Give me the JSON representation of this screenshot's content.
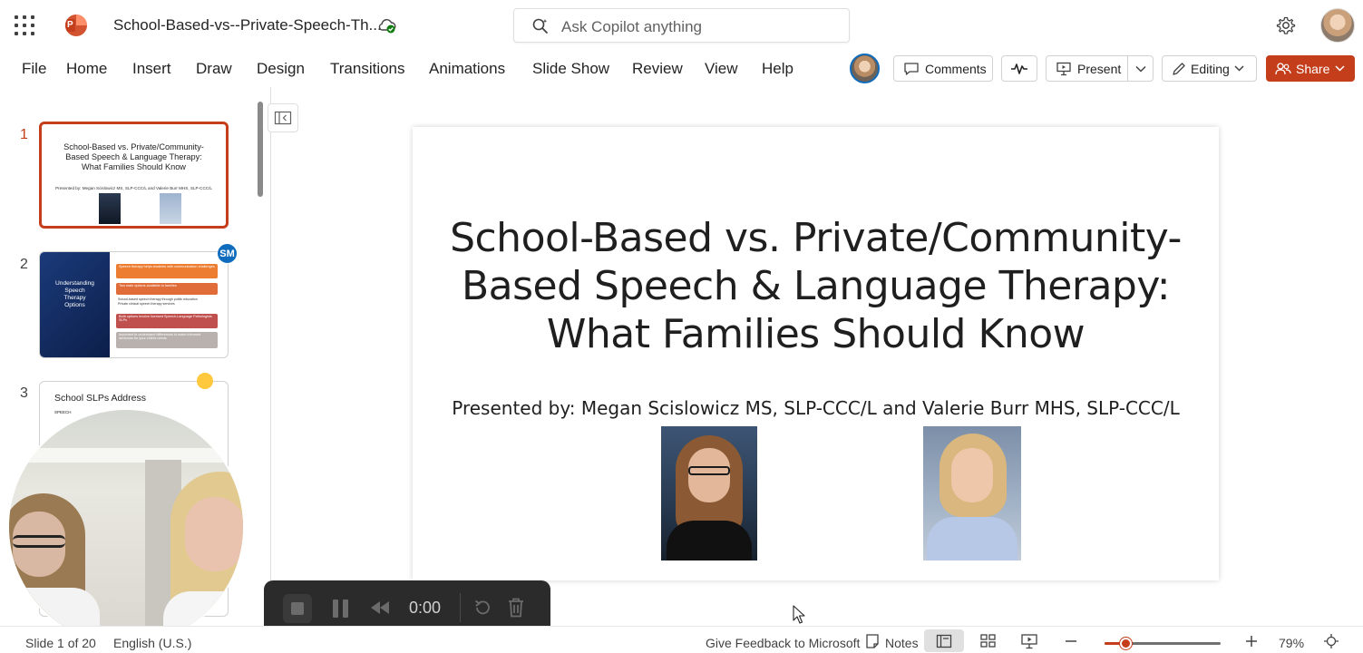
{
  "app": {
    "name": "PowerPoint",
    "doc_title": "School-Based-vs--Private-Speech-Th...",
    "save_status_icon": "cloud-saved-icon",
    "copilot_placeholder": "Ask Copilot anything",
    "accent_color": "#c43e1c"
  },
  "ribbon": {
    "tabs": [
      "File",
      "Home",
      "Insert",
      "Draw",
      "Design",
      "Transitions",
      "Animations",
      "Slide Show",
      "Review",
      "View",
      "Help"
    ],
    "comments_label": "Comments",
    "present_label": "Present",
    "editing_label": "Editing",
    "share_label": "Share"
  },
  "thumbnails": [
    {
      "number": "1",
      "title": "School-Based vs. Private/Community-\nBased Speech & Language Therapy:\nWhat Families Should Know",
      "presenters": "Presented by:  Megan Scislowicz MS, SLP-CCC/L and Valerie Burr MHS, SLP-CCC/L"
    },
    {
      "number": "2",
      "title": "Understanding\nSpeech\nTherapy\nOptions",
      "badge": "SM",
      "boxes": [
        "Speech therapy helps students with communication challenges",
        "Two main options available to families",
        "Both options involve licensed Speech-Language Pathologists SLPs",
        "Important to understand differences to make informed decisions for your child's needs"
      ],
      "bullets": [
        "School-based speech therapy through public education",
        "Private clinical speech therapy services"
      ]
    },
    {
      "number": "3",
      "title": "School SLPs Address",
      "sub": "SPEECH"
    }
  ],
  "slide": {
    "title": "School-Based vs. Private/Community-\nBased Speech & Language Therapy:\nWhat Families Should Know",
    "presenters": "Presented by: Megan Scislowicz MS, SLP-CCC/L and Valerie Burr MHS, SLP-CCC/L"
  },
  "recording": {
    "time": "0:00"
  },
  "status": {
    "slide_info": "Slide 1 of 20",
    "language": "English (U.S.)",
    "feedback": "Give Feedback to Microsoft",
    "notes": "Notes",
    "zoom_percent": "79%",
    "zoom_level": 0.18
  }
}
